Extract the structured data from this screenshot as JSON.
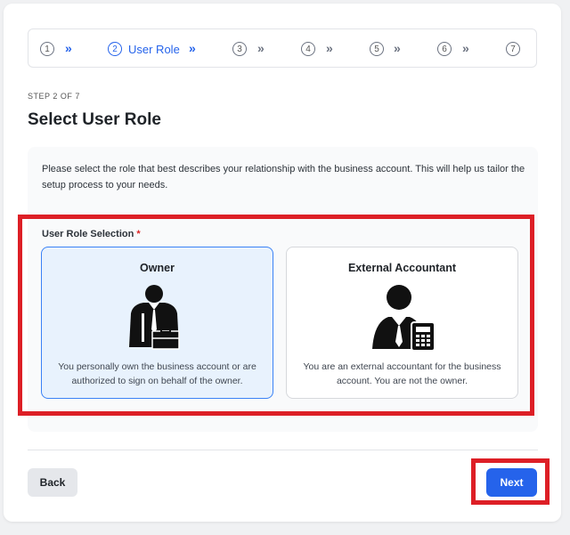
{
  "stepper": {
    "steps": [
      {
        "number": "1",
        "label": ""
      },
      {
        "number": "2",
        "label": "User Role"
      },
      {
        "number": "3",
        "label": ""
      },
      {
        "number": "4",
        "label": ""
      },
      {
        "number": "5",
        "label": ""
      },
      {
        "number": "6",
        "label": ""
      },
      {
        "number": "7",
        "label": ""
      }
    ],
    "separator": "»",
    "active_step": 2
  },
  "header": {
    "step_counter": "STEP 2 OF 7",
    "title": "Select User Role"
  },
  "form": {
    "description": "Please select the role that best describes your relationship with the business account. This will help us tailor the setup process to your needs.",
    "field_label": "User Role Selection",
    "required_marker": "*",
    "roles": [
      {
        "title": "Owner",
        "description": "You personally own the business account or are authorized to sign on behalf of the owner.",
        "selected": true,
        "icon": "owner-briefcase-icon"
      },
      {
        "title": "External Accountant",
        "description": "You are an external accountant for the business account. You are not the owner.",
        "selected": false,
        "icon": "accountant-calculator-icon"
      }
    ]
  },
  "footer": {
    "back_label": "Back",
    "next_label": "Next"
  },
  "colors": {
    "accent": "#2563eb",
    "selected_bg": "#e8f2fd",
    "highlight_box": "#dd1f26"
  }
}
